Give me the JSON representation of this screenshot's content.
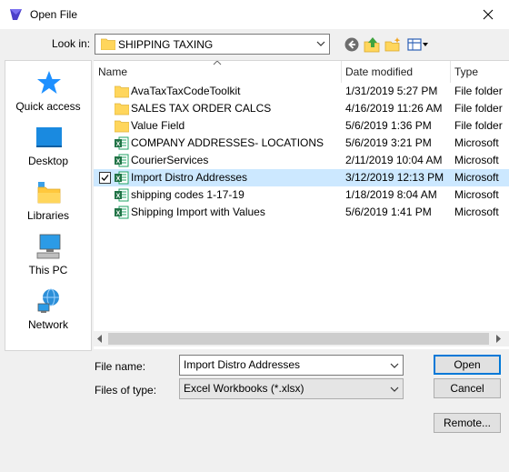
{
  "window": {
    "title": "Open File",
    "close_glyph": "✕"
  },
  "toolbar": {
    "lookin_label": "Look in:",
    "lookin_value": "SHIPPING TAXING",
    "icons": [
      "back-icon",
      "up-folder-icon",
      "new-folder-icon",
      "view-menu-icon"
    ]
  },
  "places": [
    {
      "label": "Quick access",
      "icon": "star-icon"
    },
    {
      "label": "Desktop",
      "icon": "desktop-icon"
    },
    {
      "label": "Libraries",
      "icon": "libraries-icon"
    },
    {
      "label": "This PC",
      "icon": "computer-icon"
    },
    {
      "label": "Network",
      "icon": "network-icon"
    }
  ],
  "columns": {
    "name": "Name",
    "date": "Date modified",
    "type": "Type"
  },
  "files": [
    {
      "name": "AvaTaxTaxCodeToolkit",
      "date": "1/31/2019 5:27 PM",
      "type": "File folder",
      "icon": "folder-icon",
      "selected": false
    },
    {
      "name": "SALES TAX ORDER CALCS",
      "date": "4/16/2019 11:26 AM",
      "type": "File folder",
      "icon": "folder-icon",
      "selected": false
    },
    {
      "name": "Value Field",
      "date": "5/6/2019 1:36 PM",
      "type": "File folder",
      "icon": "folder-icon",
      "selected": false
    },
    {
      "name": "COMPANY ADDRESSES- LOCATIONS",
      "date": "5/6/2019 3:21 PM",
      "type": "Microsoft",
      "icon": "excel-icon",
      "selected": false
    },
    {
      "name": "CourierServices",
      "date": "2/11/2019 10:04 AM",
      "type": "Microsoft",
      "icon": "excel-icon",
      "selected": false
    },
    {
      "name": "Import Distro Addresses",
      "date": "3/12/2019 12:13 PM",
      "type": "Microsoft",
      "icon": "excel-icon",
      "selected": true
    },
    {
      "name": "shipping codes 1-17-19",
      "date": "1/18/2019 8:04 AM",
      "type": "Microsoft",
      "icon": "excel-icon",
      "selected": false
    },
    {
      "name": "Shipping Import with Values",
      "date": "5/6/2019 1:41 PM",
      "type": "Microsoft",
      "icon": "excel-icon",
      "selected": false
    }
  ],
  "form": {
    "filename_label": "File name:",
    "filename_value": "Import Distro Addresses",
    "filetype_label": "Files of type:",
    "filetype_value": "Excel Workbooks (*.xlsx)"
  },
  "buttons": {
    "open": "Open",
    "cancel": "Cancel",
    "remote": "Remote..."
  },
  "colors": {
    "selection": "#cce8ff",
    "folder": "#ffd65c",
    "excel": "#217346",
    "accent": "#0078d7"
  }
}
